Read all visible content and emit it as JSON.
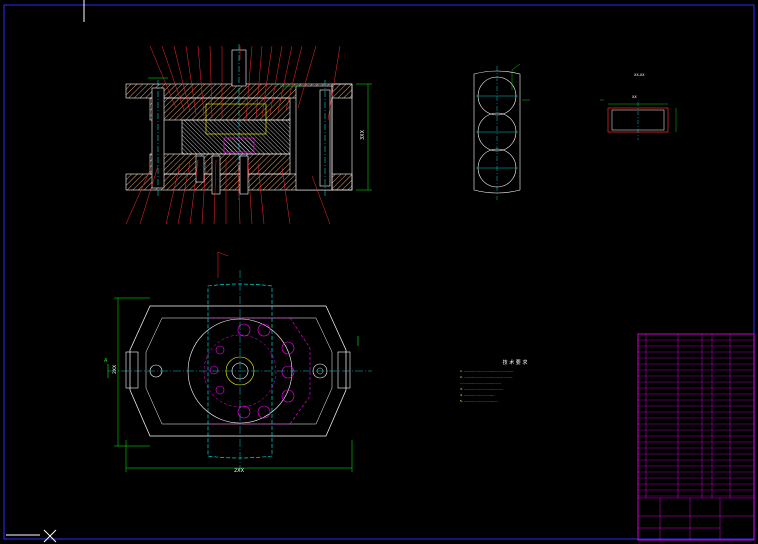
{
  "drawing": {
    "frame_color": "#2c2cff",
    "title_block_color": "#ff00ff",
    "bg": "#000000",
    "colors": {
      "outline": "#ffffff",
      "hatch": "#d9a066",
      "center": "#00ffff",
      "dim": "#00ff00",
      "leader": "#ff2a2a",
      "yellow": "#ffff00",
      "magenta": "#ff00ff",
      "blue": "#4b6bff"
    }
  },
  "dims": {
    "front_height": "3XX",
    "plan_width": "2XX",
    "plan_height": "2XX",
    "part_label_a": "XX-XX",
    "part_label_b": "XX"
  },
  "notes": {
    "title": "技 术 要 求",
    "lines": [
      "1. ....................................................",
      "2. ...................................................",
      "   ...........................................",
      "3. .........................................",
      "4. .................................",
      "5. ...................................."
    ]
  },
  "section_mark": "A"
}
